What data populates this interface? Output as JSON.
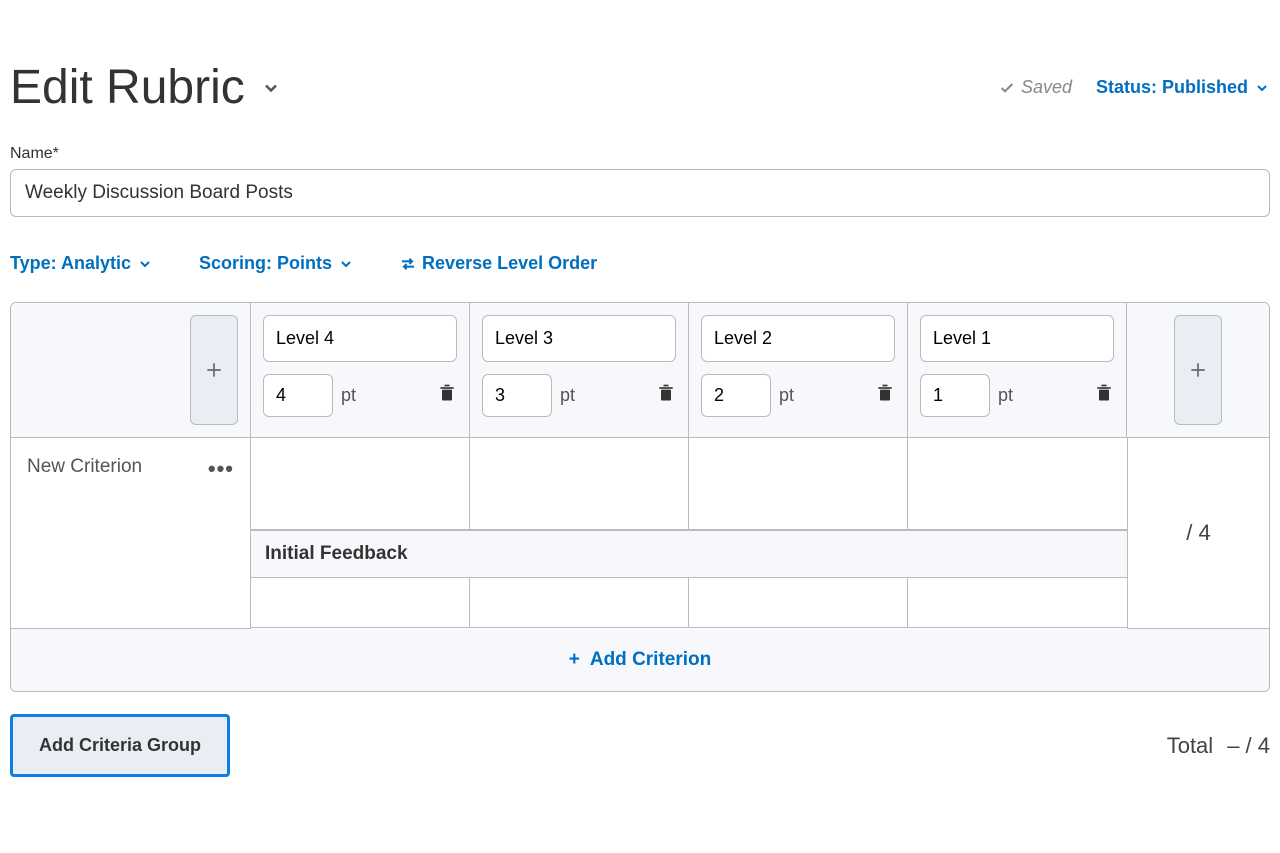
{
  "header": {
    "title": "Edit Rubric",
    "saved_label": "Saved",
    "status_label": "Status: Published"
  },
  "name_field": {
    "label": "Name*",
    "value": "Weekly Discussion Board Posts"
  },
  "options": {
    "type_label": "Type: Analytic",
    "scoring_label": "Scoring: Points",
    "reverse_label": "Reverse Level Order"
  },
  "levels": [
    {
      "name": "Level 4",
      "points": "4",
      "unit": "pt"
    },
    {
      "name": "Level 3",
      "points": "3",
      "unit": "pt"
    },
    {
      "name": "Level 2",
      "points": "2",
      "unit": "pt"
    },
    {
      "name": "Level 1",
      "points": "1",
      "unit": "pt"
    }
  ],
  "criterion": {
    "name": "New Criterion",
    "out_of": "/ 4",
    "feedback_label": "Initial Feedback"
  },
  "actions": {
    "add_criterion": "Add Criterion",
    "add_criteria_group": "Add Criteria Group"
  },
  "footer": {
    "total_label": "Total",
    "total_value": "– / 4"
  }
}
